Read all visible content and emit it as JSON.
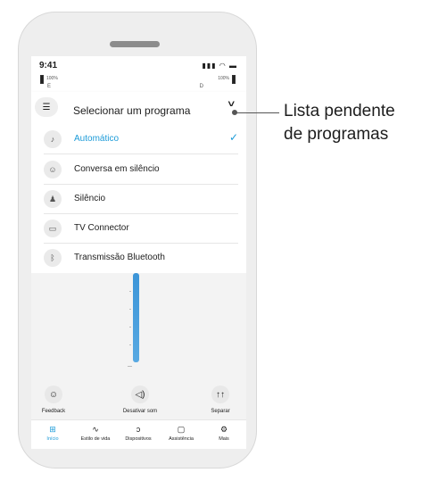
{
  "status_bar": {
    "time": "9:41",
    "signal_icons": "▮▮▮ ◠ ▬",
    "left_battery": "100%",
    "right_battery": "100%",
    "left_side": "E",
    "right_side": "D"
  },
  "dropdown": {
    "title": "Selecionar um programa",
    "menu_icon": "☰",
    "caret": "˅",
    "items": [
      {
        "label": "Automático",
        "icon": "automatic-icon",
        "glyph": "♪",
        "selected": true
      },
      {
        "label": "Conversa em silêncio",
        "icon": "conversation-icon",
        "glyph": "☺",
        "selected": false
      },
      {
        "label": "Silêncio",
        "icon": "people-icon",
        "glyph": "♟",
        "selected": false
      },
      {
        "label": "TV Connector",
        "icon": "tv-icon",
        "glyph": "▭",
        "selected": false
      },
      {
        "label": "Transmissão Bluetooth",
        "icon": "bluetooth-icon",
        "glyph": "ᛒ",
        "selected": false
      }
    ],
    "check": "✓"
  },
  "actions": {
    "feedback": {
      "label": "Feedback",
      "glyph": "☺"
    },
    "mute": {
      "label": "Desativar som",
      "glyph": "◁)"
    },
    "separate": {
      "label": "Separar",
      "glyph": "↑↑"
    }
  },
  "volume": {
    "level": 0.85
  },
  "tabs": [
    {
      "label": "Início",
      "icon": "home-grid-icon",
      "glyph": "⊞",
      "active": true
    },
    {
      "label": "Estilo de vida",
      "icon": "activity-icon",
      "glyph": "∿",
      "active": false
    },
    {
      "label": "Dispositivos",
      "icon": "hearing-aid-icon",
      "glyph": "ↄ",
      "active": false
    },
    {
      "label": "Assistência",
      "icon": "chat-icon",
      "glyph": "▢",
      "active": false
    },
    {
      "label": "Mais",
      "icon": "gear-icon",
      "glyph": "⚙",
      "active": false
    }
  ],
  "callout": {
    "line1": "Lista pendente",
    "line2": "de programas"
  }
}
